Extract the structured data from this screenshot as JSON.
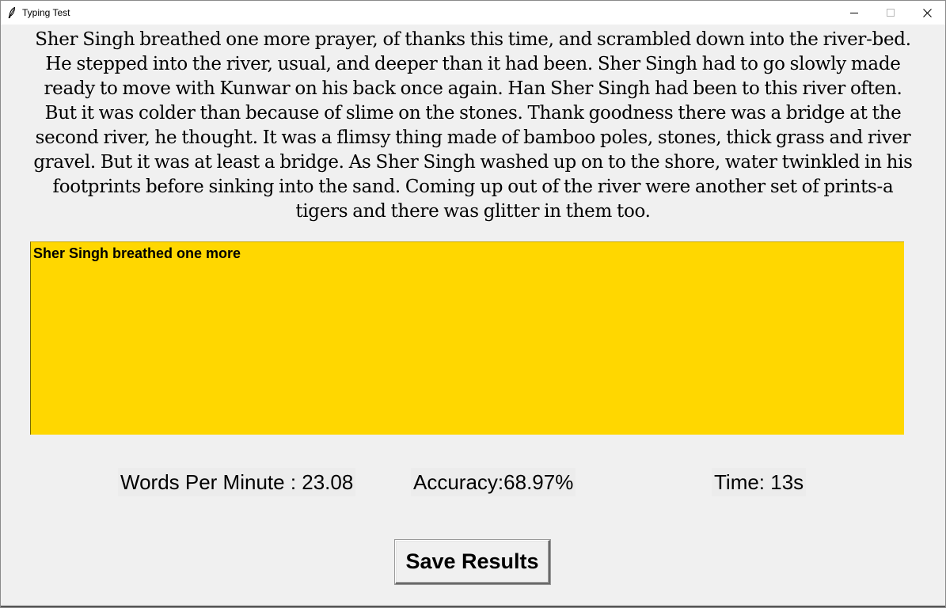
{
  "window": {
    "title": "Typing Test",
    "controls": [
      "minimize-icon",
      "maximize-icon",
      "close-icon"
    ]
  },
  "passage": {
    "lines": [
      "Sher Singh breathed one more prayer, of thanks this time, and scrambled down into the river-bed.",
      "He stepped into the river, usual, and deeper than it had been. Sher Singh had to go slowly made",
      "ready to move with Kunwar on his back once again. Han Sher Singh had been to this river often.",
      "But it was colder than because of slime on the stones. Thank goodness there was a bridge at the",
      "second river, he thought. It was a flimsy thing made of bamboo poles, stones, thick grass and river",
      "gravel. But it was at least a bridge. As Sher Singh washed up on to the shore, water twinkled in his",
      "footprints before sinking into the sand. Coming up out of the river were another set of prints-a",
      "tigers and there was glitter in them too."
    ]
  },
  "typing_area": {
    "value": "Sher Singh breathed one more",
    "background": "#ffd700"
  },
  "stats": {
    "wpm": "Words Per Minute : 23.08",
    "accuracy": "Accuracy:68.97%",
    "time": "Time: 13s"
  },
  "actions": {
    "save_label": "Save Results"
  }
}
